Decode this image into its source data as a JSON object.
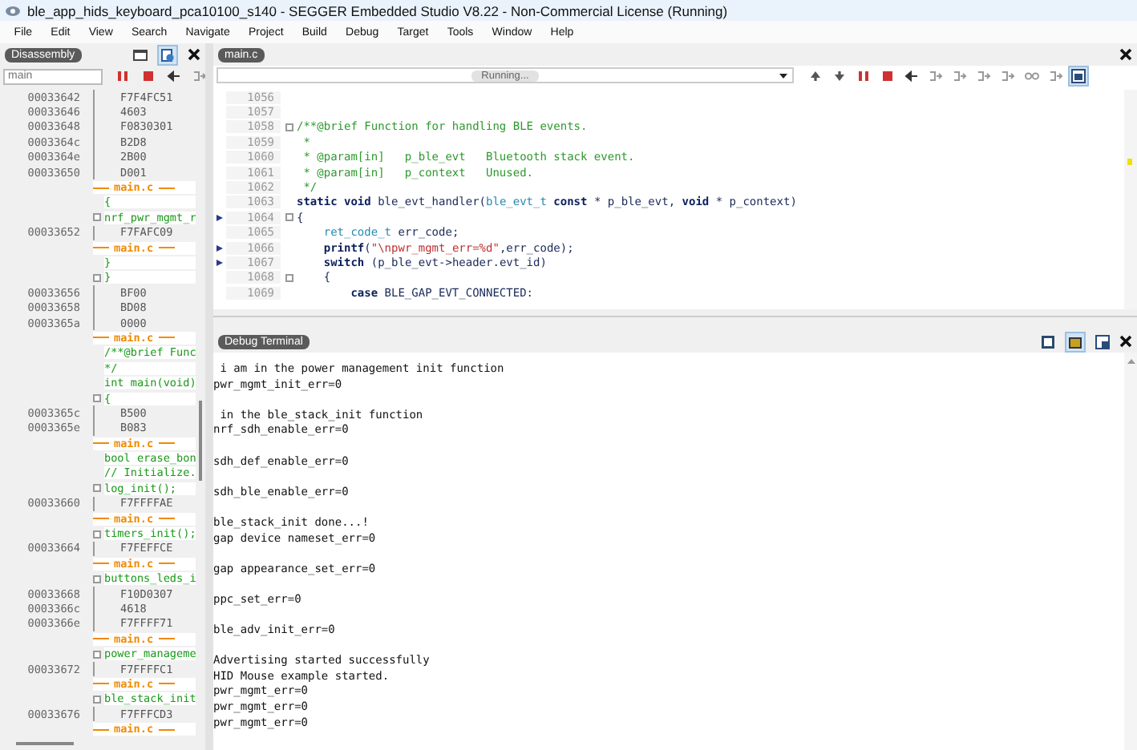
{
  "window": {
    "title": "ble_app_hids_keyboard_pca10100_s140 - SEGGER Embedded Studio V8.22 - Non-Commercial License (Running)"
  },
  "menu": [
    "File",
    "Edit",
    "View",
    "Search",
    "Navigate",
    "Project",
    "Build",
    "Debug",
    "Target",
    "Tools",
    "Window",
    "Help"
  ],
  "disassembly": {
    "title": "Disassembly",
    "search": {
      "placeholder": "main"
    },
    "toolbar": [
      {
        "kind": "pause",
        "disabled": false
      },
      {
        "kind": "stop",
        "disabled": false
      },
      {
        "kind": "back",
        "disabled": false
      },
      {
        "kind": "step",
        "disabled": true
      }
    ],
    "rows": [
      {
        "kind": "code",
        "address": "00033642",
        "text": "F7F4FC51"
      },
      {
        "kind": "code",
        "address": "00033646",
        "text": "4603"
      },
      {
        "kind": "code",
        "address": "00033648",
        "text": "F0830301"
      },
      {
        "kind": "code",
        "address": "0003364c",
        "text": "B2D8"
      },
      {
        "kind": "code",
        "address": "0003364e",
        "text": "2B00"
      },
      {
        "kind": "code",
        "address": "00033650",
        "text": "D001"
      },
      {
        "kind": "file",
        "text": "main.c"
      },
      {
        "kind": "source",
        "fold": false,
        "text": "{"
      },
      {
        "kind": "source",
        "fold": true,
        "text": "nrf_pwr_mgmt_r"
      },
      {
        "kind": "code",
        "address": "00033652",
        "text": "F7FAFC09"
      },
      {
        "kind": "file",
        "text": "main.c"
      },
      {
        "kind": "source",
        "fold": false,
        "text": "}"
      },
      {
        "kind": "source",
        "fold": true,
        "text": "}"
      },
      {
        "kind": "code",
        "address": "00033656",
        "text": "BF00"
      },
      {
        "kind": "code",
        "address": "00033658",
        "text": "BD08"
      },
      {
        "kind": "code",
        "address": "0003365a",
        "text": "0000"
      },
      {
        "kind": "file",
        "text": "main.c"
      },
      {
        "kind": "source",
        "fold": false,
        "text": "/**@brief Func"
      },
      {
        "kind": "source",
        "fold": false,
        "text": "*/"
      },
      {
        "kind": "source",
        "fold": false,
        "text": "int main(void)"
      },
      {
        "kind": "source",
        "fold": true,
        "text": "{"
      },
      {
        "kind": "code",
        "address": "0003365c",
        "text": "B500"
      },
      {
        "kind": "code",
        "address": "0003365e",
        "text": "B083"
      },
      {
        "kind": "file",
        "text": "main.c"
      },
      {
        "kind": "source",
        "fold": false,
        "text": "bool erase_bon"
      },
      {
        "kind": "source",
        "fold": false,
        "text": "// Initialize."
      },
      {
        "kind": "source",
        "fold": true,
        "text": "log_init();"
      },
      {
        "kind": "code",
        "address": "00033660",
        "text": "F7FFFFAE"
      },
      {
        "kind": "file",
        "text": "main.c"
      },
      {
        "kind": "source",
        "fold": true,
        "text": "timers_init();"
      },
      {
        "kind": "code",
        "address": "00033664",
        "text": "F7FEFFCE"
      },
      {
        "kind": "file",
        "text": "main.c"
      },
      {
        "kind": "source",
        "fold": true,
        "text": "buttons_leds_i"
      },
      {
        "kind": "code",
        "address": "00033668",
        "text": "F10D0307"
      },
      {
        "kind": "code",
        "address": "0003366c",
        "text": "4618"
      },
      {
        "kind": "code",
        "address": "0003366e",
        "text": "F7FFFF71"
      },
      {
        "kind": "file",
        "text": "main.c"
      },
      {
        "kind": "source",
        "fold": true,
        "text": "power_manageme"
      },
      {
        "kind": "code",
        "address": "00033672",
        "text": "F7FFFFC1"
      },
      {
        "kind": "file",
        "text": "main.c"
      },
      {
        "kind": "source",
        "fold": true,
        "text": "ble_stack_init"
      },
      {
        "kind": "code",
        "address": "00033676",
        "text": "F7FFFCD3"
      },
      {
        "kind": "file",
        "text": "main.c"
      }
    ]
  },
  "editor": {
    "tab": "main.c",
    "status": "Running...",
    "toolbar": [
      {
        "kind": "up",
        "disabled": false
      },
      {
        "kind": "down",
        "disabled": false
      },
      {
        "kind": "pause",
        "disabled": false
      },
      {
        "kind": "stop",
        "disabled": false
      },
      {
        "kind": "back",
        "disabled": false
      },
      {
        "kind": "step",
        "disabled": true
      },
      {
        "kind": "step",
        "disabled": true
      },
      {
        "kind": "step",
        "disabled": true
      },
      {
        "kind": "step",
        "disabled": true
      },
      {
        "kind": "glasses",
        "disabled": true
      },
      {
        "kind": "step",
        "disabled": true
      }
    ],
    "lines": [
      {
        "number": "1056",
        "marker": false,
        "fold": false
      },
      {
        "number": "1057",
        "marker": false,
        "fold": false
      },
      {
        "number": "1058",
        "marker": false,
        "fold": true,
        "tokens": [
          {
            "kind": "comment",
            "text": "/**@brief Function for handling BLE events."
          }
        ]
      },
      {
        "number": "1059",
        "marker": false,
        "fold": false,
        "tokens": [
          {
            "kind": "comment",
            "text": " *"
          }
        ]
      },
      {
        "number": "1060",
        "marker": false,
        "fold": false,
        "tokens": [
          {
            "kind": "comment",
            "text": " * @param[in]   p_ble_evt   Bluetooth stack event."
          }
        ]
      },
      {
        "number": "1061",
        "marker": false,
        "fold": false,
        "tokens": [
          {
            "kind": "comment",
            "text": " * @param[in]   p_context   Unused."
          }
        ]
      },
      {
        "number": "1062",
        "marker": false,
        "fold": false,
        "tokens": [
          {
            "kind": "comment",
            "text": " */"
          }
        ]
      },
      {
        "number": "1063",
        "marker": false,
        "fold": false,
        "tokens": [
          {
            "kind": "keyword",
            "text": "static void"
          },
          {
            "kind": "plain",
            "text": " ble_evt_handler("
          },
          {
            "kind": "type",
            "text": "ble_evt_t"
          },
          {
            "kind": "keyword",
            "text": " const"
          },
          {
            "kind": "plain",
            "text": " * p_ble_evt, "
          },
          {
            "kind": "keyword",
            "text": "void"
          },
          {
            "kind": "plain",
            "text": " * p_context)"
          }
        ]
      },
      {
        "number": "1064",
        "marker": true,
        "fold": true,
        "tokens": [
          {
            "kind": "plain",
            "text": "{"
          }
        ]
      },
      {
        "number": "1065",
        "marker": false,
        "fold": false,
        "tokens": [
          {
            "kind": "type",
            "text": "    ret_code_t"
          },
          {
            "kind": "plain",
            "text": " err_code;"
          }
        ]
      },
      {
        "number": "1066",
        "marker": true,
        "fold": false,
        "tokens": [
          {
            "kind": "keyword",
            "text": "    printf"
          },
          {
            "kind": "plain",
            "text": "("
          },
          {
            "kind": "string",
            "text": "\"\\npwr_mgmt_err=%d\""
          },
          {
            "kind": "plain",
            "text": ",err_code);"
          }
        ]
      },
      {
        "number": "1067",
        "marker": true,
        "fold": false,
        "tokens": [
          {
            "kind": "keyword",
            "text": "    switch"
          },
          {
            "kind": "plain",
            "text": " (p_ble_evt->header.evt_id)"
          }
        ]
      },
      {
        "number": "1068",
        "marker": false,
        "fold": true,
        "tokens": [
          {
            "kind": "plain",
            "text": "    {"
          }
        ]
      },
      {
        "number": "1069",
        "marker": false,
        "fold": false,
        "tokens": [
          {
            "kind": "keyword",
            "text": "        case"
          },
          {
            "kind": "plain",
            "text": " BLE_GAP_EVT_CONNECTED:"
          }
        ]
      }
    ]
  },
  "terminal": {
    "title": "Debug Terminal",
    "blocks": [
      [
        " i am in the power management init function",
        "pwr_mgmt_init_err=0"
      ],
      [
        " in the ble_stack_init function",
        "nrf_sdh_enable_err=0"
      ],
      [
        "sdh_def_enable_err=0"
      ],
      [
        "sdh_ble_enable_err=0"
      ],
      [
        "ble_stack_init done...!",
        "gap device nameset_err=0"
      ],
      [
        "gap appearance_set_err=0"
      ],
      [
        "ppc_set_err=0"
      ],
      [
        "ble_adv_init_err=0"
      ],
      [
        "Advertising started successfully",
        "HID Mouse example started.",
        "pwr_mgmt_err=0",
        "pwr_mgmt_err=0",
        "pwr_mgmt_err=0"
      ]
    ]
  }
}
